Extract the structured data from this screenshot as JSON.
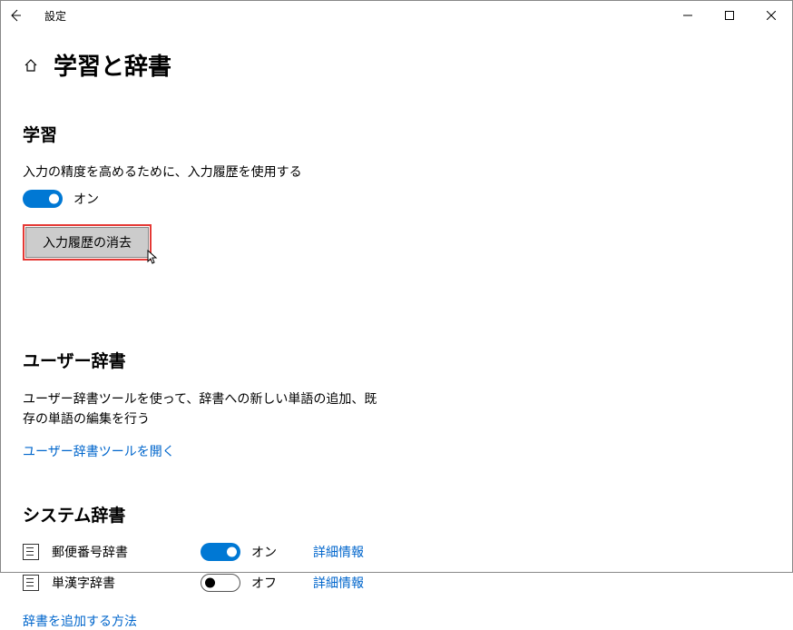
{
  "titlebar": {
    "title": "設定"
  },
  "page": {
    "title": "学習と辞書"
  },
  "sections": {
    "learning": {
      "heading": "学習",
      "description": "入力の精度を高めるために、入力履歴を使用する",
      "toggle_state": "オン",
      "clear_button": "入力履歴の消去"
    },
    "user_dict": {
      "heading": "ユーザー辞書",
      "description": "ユーザー辞書ツールを使って、辞書への新しい単語の追加、既存の単語の編集を行う",
      "link": "ユーザー辞書ツールを開く"
    },
    "system_dict": {
      "heading": "システム辞書",
      "items": [
        {
          "name": "郵便番号辞書",
          "state": "オン",
          "detail": "詳細情報",
          "on": true
        },
        {
          "name": "単漢字辞書",
          "state": "オフ",
          "detail": "詳細情報",
          "on": false
        }
      ],
      "add_link": "辞書を追加する方法"
    }
  }
}
